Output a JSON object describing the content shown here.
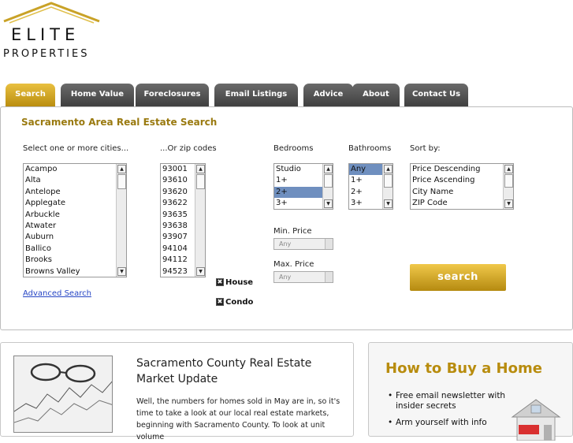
{
  "logo": {
    "line1": "ELITE",
    "line2": "PROPERTIES"
  },
  "colors": {
    "accent": "#b88c0e",
    "tab_inactive": "#4e4e4e",
    "link": "#2645c4",
    "selection": "#6f8fbf"
  },
  "tabs": [
    {
      "label": "Search",
      "active": true
    },
    {
      "label": "Home Value"
    },
    {
      "label": "Foreclosures"
    },
    {
      "label": "Email Listings"
    },
    {
      "label": "Advice"
    },
    {
      "label": "About"
    },
    {
      "label": "Contact Us"
    }
  ],
  "search": {
    "title": "Sacramento Area Real Estate Search",
    "cities_label": "Select one or more cities...",
    "cities": [
      "Acampo",
      "Alta",
      "Antelope",
      "Applegate",
      "Arbuckle",
      "Atwater",
      "Auburn",
      "Ballico",
      "Brooks",
      "Browns Valley"
    ],
    "zips_label": "...Or zip codes",
    "zips": [
      "93001",
      "93610",
      "93620",
      "93622",
      "93635",
      "93638",
      "93907",
      "94104",
      "94112",
      "94523"
    ],
    "bedrooms_label": "Bedrooms",
    "bedrooms": [
      "Studio",
      "1+",
      "2+",
      "3+"
    ],
    "bedrooms_selected": "2+",
    "bathrooms_label": "Bathrooms",
    "bathrooms": [
      "Any",
      "1+",
      "2+",
      "3+"
    ],
    "bathrooms_selected": "Any",
    "sort_label": "Sort by:",
    "sort_options": [
      "Price Descending",
      "Price Ascending",
      "City Name",
      "ZIP Code"
    ],
    "min_price_label": "Min. Price",
    "min_price_value": "Any",
    "max_price_label": "Max. Price",
    "max_price_value": "Any",
    "house_label": "House",
    "condo_label": "Condo",
    "advanced_link": "Advanced Search",
    "search_button": "search"
  },
  "news": {
    "title": "Sacramento County Real Estate Market Update",
    "body": "Well, the numbers for homes sold in May are in, so it's time to take a look at our local real estate markets, beginning with Sacramento County. To look at unit volume"
  },
  "side": {
    "title": "How to Buy a Home",
    "items": [
      "Free email newsletter with insider secrets",
      "Arm yourself with info"
    ]
  }
}
